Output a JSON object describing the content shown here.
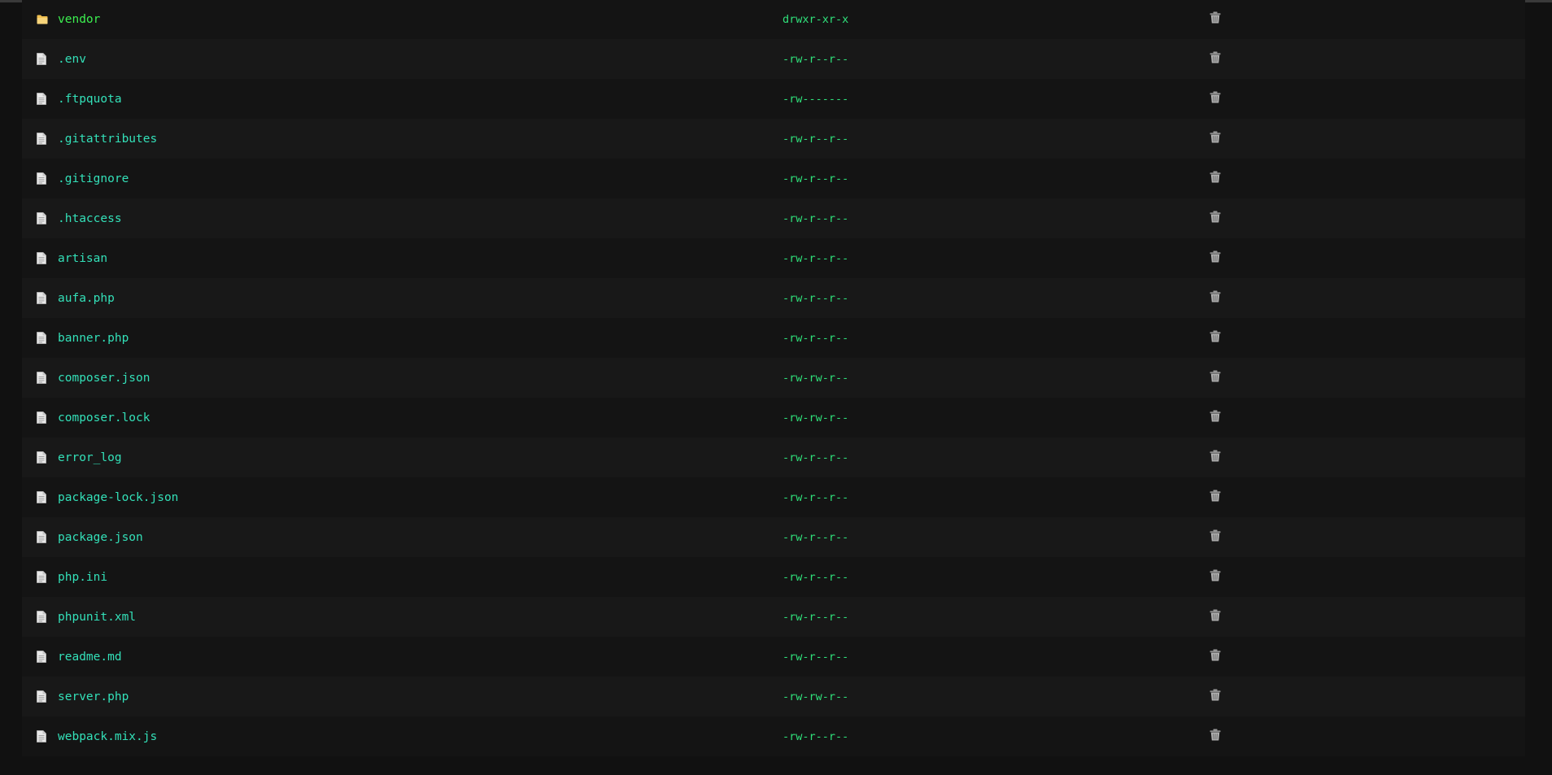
{
  "files": [
    {
      "name": "vendor",
      "perm": "drwxr-xr-x",
      "type": "folder",
      "icon": "folder-icon",
      "action_icon": "trash-icon"
    },
    {
      "name": ".env",
      "perm": "-rw-r--r--",
      "type": "file",
      "icon": "file-icon",
      "action_icon": "trash-icon"
    },
    {
      "name": ".ftpquota",
      "perm": "-rw-------",
      "type": "file",
      "icon": "file-icon",
      "action_icon": "trash-icon"
    },
    {
      "name": ".gitattributes",
      "perm": "-rw-r--r--",
      "type": "file",
      "icon": "file-icon",
      "action_icon": "trash-icon"
    },
    {
      "name": ".gitignore",
      "perm": "-rw-r--r--",
      "type": "file",
      "icon": "file-icon",
      "action_icon": "trash-icon"
    },
    {
      "name": ".htaccess",
      "perm": "-rw-r--r--",
      "type": "file",
      "icon": "file-icon",
      "action_icon": "trash-icon"
    },
    {
      "name": "artisan",
      "perm": "-rw-r--r--",
      "type": "file",
      "icon": "file-icon",
      "action_icon": "trash-icon"
    },
    {
      "name": "aufa.php",
      "perm": "-rw-r--r--",
      "type": "file",
      "icon": "file-icon",
      "action_icon": "trash-icon"
    },
    {
      "name": "banner.php",
      "perm": "-rw-r--r--",
      "type": "file",
      "icon": "file-icon",
      "action_icon": "trash-icon"
    },
    {
      "name": "composer.json",
      "perm": "-rw-rw-r--",
      "type": "file",
      "icon": "file-icon",
      "action_icon": "trash-icon"
    },
    {
      "name": "composer.lock",
      "perm": "-rw-rw-r--",
      "type": "file",
      "icon": "file-icon",
      "action_icon": "trash-icon"
    },
    {
      "name": "error_log",
      "perm": "-rw-r--r--",
      "type": "file",
      "icon": "file-icon",
      "action_icon": "trash-icon"
    },
    {
      "name": "package-lock.json",
      "perm": "-rw-r--r--",
      "type": "file",
      "icon": "file-icon",
      "action_icon": "trash-icon"
    },
    {
      "name": "package.json",
      "perm": "-rw-r--r--",
      "type": "file",
      "icon": "file-icon",
      "action_icon": "trash-icon"
    },
    {
      "name": "php.ini",
      "perm": "-rw-r--r--",
      "type": "file",
      "icon": "file-icon",
      "action_icon": "trash-icon"
    },
    {
      "name": "phpunit.xml",
      "perm": "-rw-r--r--",
      "type": "file",
      "icon": "file-icon",
      "action_icon": "trash-icon"
    },
    {
      "name": "readme.md",
      "perm": "-rw-r--r--",
      "type": "file",
      "icon": "file-icon",
      "action_icon": "trash-icon"
    },
    {
      "name": "server.php",
      "perm": "-rw-rw-r--",
      "type": "file",
      "icon": "file-icon",
      "action_icon": "trash-icon"
    },
    {
      "name": "webpack.mix.js",
      "perm": "-rw-r--r--",
      "type": "file",
      "icon": "file-icon",
      "action_icon": "trash-icon"
    }
  ],
  "colors": {
    "background": "#111111",
    "file_name": "#33e0b8",
    "folder_name": "#3cf050",
    "permission": "#2fe07a",
    "folder_icon": "#f0c050"
  }
}
